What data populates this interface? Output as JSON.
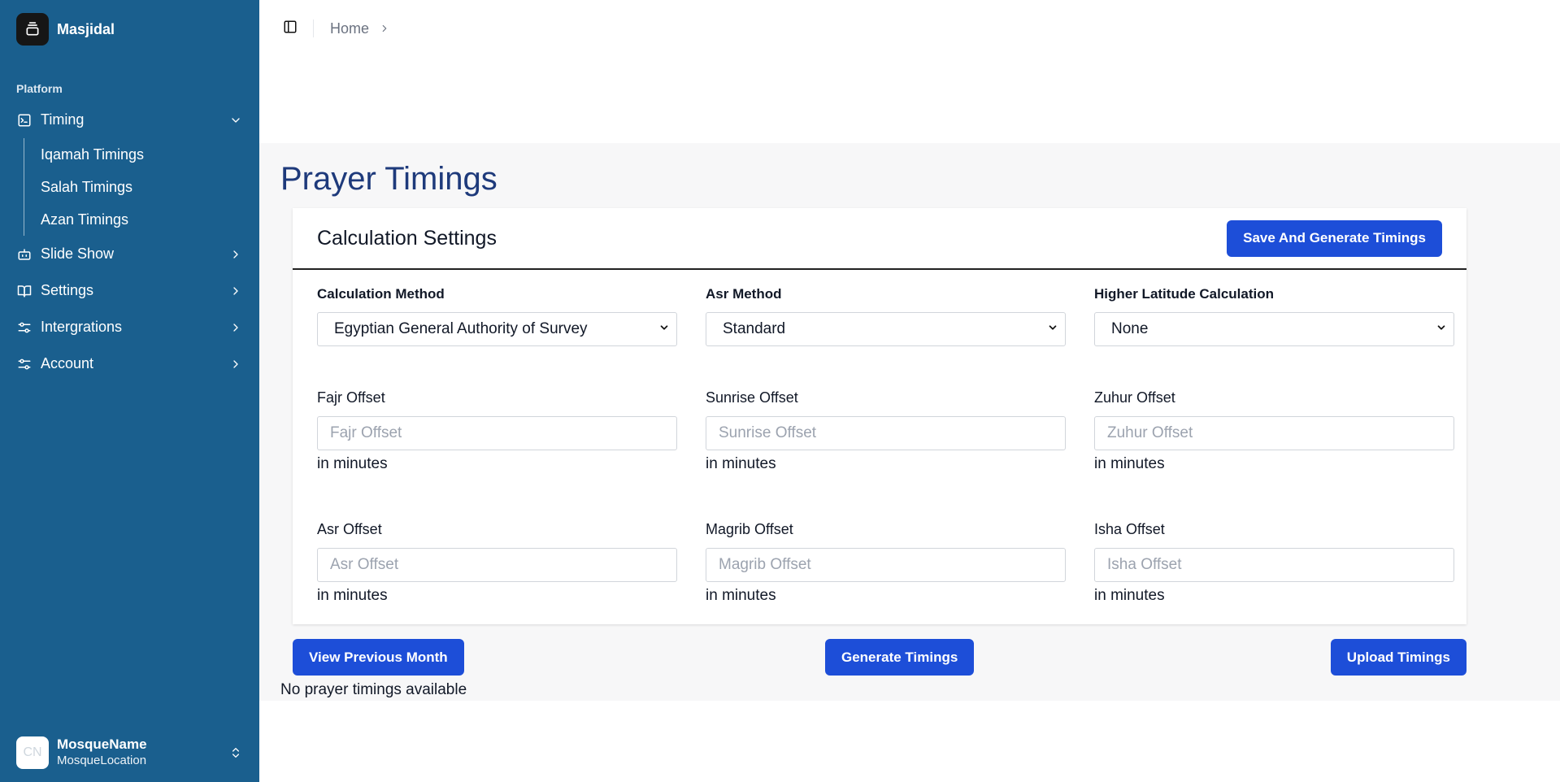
{
  "brand": {
    "name": "Masjidal",
    "logo_icon": "stack-icon"
  },
  "sidebar": {
    "group_label": "Platform",
    "items": [
      {
        "label": "Timing",
        "icon": "terminal-square-icon",
        "expanded": true,
        "children": [
          {
            "label": "Iqamah Timings"
          },
          {
            "label": "Salah Timings"
          },
          {
            "label": "Azan Timings"
          }
        ]
      },
      {
        "label": "Slide Show",
        "icon": "bot-icon"
      },
      {
        "label": "Settings",
        "icon": "book-open-icon"
      },
      {
        "label": "Intergrations",
        "icon": "settings-sliders-icon"
      },
      {
        "label": "Account",
        "icon": "settings-sliders-icon"
      }
    ],
    "user": {
      "initials": "CN",
      "name": "MosqueName",
      "location": "MosqueLocation"
    }
  },
  "breadcrumb": {
    "home": "Home"
  },
  "page": {
    "title": "Prayer Timings"
  },
  "card": {
    "title": "Calculation Settings",
    "save_button": "Save And Generate Timings",
    "selects": {
      "calculation_method": {
        "label": "Calculation Method",
        "value": "Egyptian General Authority of Survey"
      },
      "asr_method": {
        "label": "Asr Method",
        "value": "Standard"
      },
      "higher_latitude": {
        "label": "Higher Latitude Calculation",
        "value": "None"
      }
    },
    "offsets": {
      "fajr": {
        "label": "Fajr Offset",
        "placeholder": "Fajr Offset",
        "hint": "in minutes"
      },
      "sunrise": {
        "label": "Sunrise Offset",
        "placeholder": "Sunrise Offset",
        "hint": "in minutes"
      },
      "zuhur": {
        "label": "Zuhur Offset",
        "placeholder": "Zuhur Offset",
        "hint": "in minutes"
      },
      "asr": {
        "label": "Asr Offset",
        "placeholder": "Asr Offset",
        "hint": "in minutes"
      },
      "magrib": {
        "label": "Magrib Offset",
        "placeholder": "Magrib Offset",
        "hint": "in minutes"
      },
      "isha": {
        "label": "Isha Offset",
        "placeholder": "Isha Offset",
        "hint": "in minutes"
      }
    }
  },
  "actions": {
    "view_previous": "View Previous Month",
    "generate": "Generate Timings",
    "upload": "Upload Timings"
  },
  "empty_message": "No prayer timings available",
  "colors": {
    "sidebar_bg": "#1a5f8e",
    "primary_button": "#1d4ed8",
    "title": "#1e3a7b",
    "content_bg": "#f7f7f8"
  }
}
